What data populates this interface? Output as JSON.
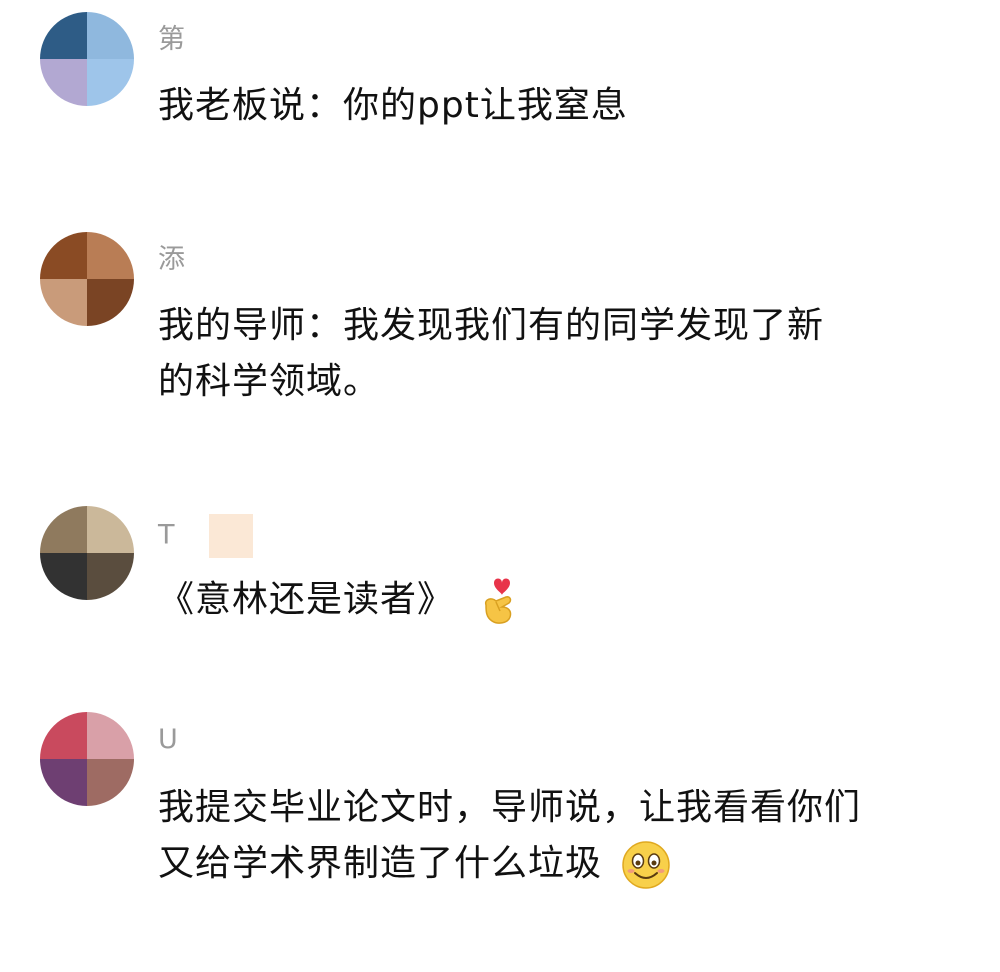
{
  "comments": [
    {
      "username": "第",
      "text_lines": [
        "我老板说：你的ppt让我窒息"
      ],
      "avatar_colors": [
        "#2e5c86",
        "#8fb8de",
        "#b2a8d2",
        "#9ec5ea"
      ],
      "emoji": ""
    },
    {
      "username": "添",
      "text_lines": [
        "我的导师：我发现我们有的同学发现了新",
        "的科学领域。"
      ],
      "avatar_colors": [
        "#8a4b24",
        "#b97d55",
        "#c99b7a",
        "#7a4424"
      ],
      "emoji": ""
    },
    {
      "username": "T",
      "text_lines": [
        "《意林还是读者》"
      ],
      "avatar_colors": [
        "#8f7a5e",
        "#cbb89a",
        "#323232",
        "#5a4d3e"
      ],
      "emoji": "finger-heart-icon"
    },
    {
      "username": "U",
      "text_lines": [
        "我提交毕业论文时，导师说，让我看看你们",
        "又给学术界制造了什么垃圾"
      ],
      "avatar_colors": [
        "#c94a5e",
        "#d9a0a8",
        "#6e3f72",
        "#9e6b63"
      ],
      "emoji": "smiling-face-icon"
    }
  ]
}
